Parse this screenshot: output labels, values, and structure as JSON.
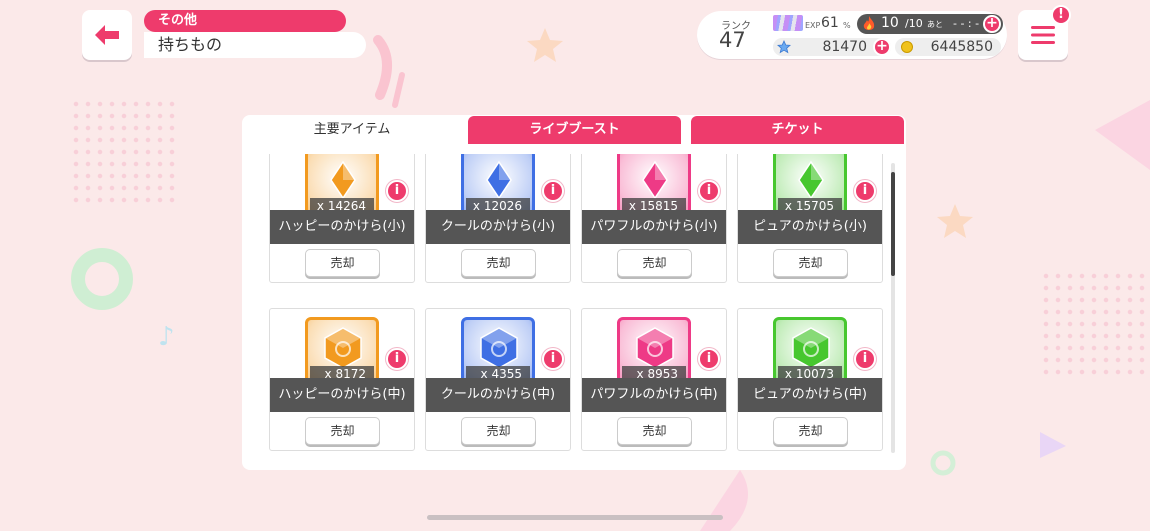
{
  "header": {
    "breadcrumb": "その他",
    "title": "持ちもの"
  },
  "status": {
    "rank_label": "ランク",
    "rank": "47",
    "exp_label": "EXP",
    "exp_value": "61",
    "exp_unit": "%",
    "stamina": "10",
    "stamina_max": "/10",
    "stamina_ato": "あと",
    "stamina_time": "- - : - -",
    "stars": "81470",
    "coins": "6445850",
    "menu_badge": "!"
  },
  "tabs": [
    {
      "label": "主要アイテム",
      "active": true
    },
    {
      "label": "ライブブースト",
      "active": false
    },
    {
      "label": "チケット",
      "active": false
    }
  ],
  "sell_label": "売却",
  "info_label": "i",
  "colors": {
    "accent": "#ee3b6c",
    "happy": "#f29a1f",
    "cool": "#3f6fe4",
    "powerful": "#ee3a86",
    "pure": "#47c72f"
  },
  "items": [
    {
      "name": "ハッピーのかけら(小)",
      "qty": "x 14264",
      "attr": "happy",
      "size": "small"
    },
    {
      "name": "クールのかけら(小)",
      "qty": "x 12026",
      "attr": "cool",
      "size": "small"
    },
    {
      "name": "パワフルのかけら(小)",
      "qty": "x 15815",
      "attr": "powerful",
      "size": "small"
    },
    {
      "name": "ピュアのかけら(小)",
      "qty": "x 15705",
      "attr": "pure",
      "size": "small"
    },
    {
      "name": "ハッピーのかけら(中)",
      "qty": "x 8172",
      "attr": "happy",
      "size": "medium"
    },
    {
      "name": "クールのかけら(中)",
      "qty": "x 4355",
      "attr": "cool",
      "size": "medium"
    },
    {
      "name": "パワフルのかけら(中)",
      "qty": "x 8953",
      "attr": "powerful",
      "size": "medium"
    },
    {
      "name": "ピュアのかけら(中)",
      "qty": "x 10073",
      "attr": "pure",
      "size": "medium"
    }
  ]
}
